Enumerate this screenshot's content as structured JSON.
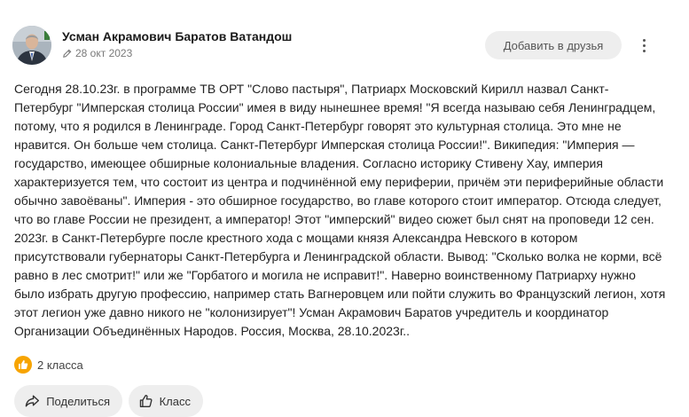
{
  "author": {
    "name": "Усман Акрамович Баратов Ватандош",
    "avatar": "avatar-photo"
  },
  "post": {
    "date": "28 окт 2023",
    "date_icon": "pencil-icon",
    "text": "Сегодня 28.10.23г. в программе ТВ ОРТ \"Слово пастыря\", Патриарх Московский Кирилл назвал Санкт-Петербург \"Имперская столица России\" имея в виду нынешнее время! \"Я всегда называю себя Ленинградцем, потому, что я родился в Ленинграде. Город Санкт-Петербург говорят это культурная столица. Это мне не нравится. Он больше чем столица. Санкт-Петербург Имперская столица России!\". Википедия: \"Империя — государство, имеющее обширные колониальные владения. Согласно историку Стивену Хау, империя характеризуется тем, что состоит из центра и подчинённой ему периферии, причём эти периферийные области обычно завоёваны\". Империя - это обширное государство, во главе которого стоит император. Отсюда следует, что во главе России не президент, а император! Этот \"имперский\" видео сюжет был снят на проповеди 12 сен. 2023г. в Санкт-Петербурге после крестного хода с мощами князя Александра Невского в котором присутствовали губернаторы Санкт-Петербурга и Ленинградской области. Вывод: \"Сколько волка не корми, всё равно в лес смотрит!\" или же \"Горбатого и могила не исправит!\". Наверно воинственному Патриарху нужно было избрать другую профессию, например стать Вагнеровцем или пойти служить во Французский легион, хотя этот легион уже давно никого не \"колонизирует\"! Усман Акрамович Баратов учредитель и координатор Организации Объединённых Народов. Россия, Москва, 28.10.2023г.."
  },
  "header": {
    "add_friend_label": "Добавить в друзья",
    "more_icon": "more-vertical-icon"
  },
  "reactions": {
    "count_label": "2 класса",
    "icon": "thumbs-up-icon"
  },
  "actions": {
    "share_label": "Поделиться",
    "share_icon": "share-icon",
    "like_label": "Класс",
    "like_icon": "thumbs-up-outline-icon"
  },
  "colors": {
    "accent_reaction": "#f7a400",
    "button_bg": "#eeeeee",
    "text": "#222222",
    "muted": "#7a7a7a"
  }
}
